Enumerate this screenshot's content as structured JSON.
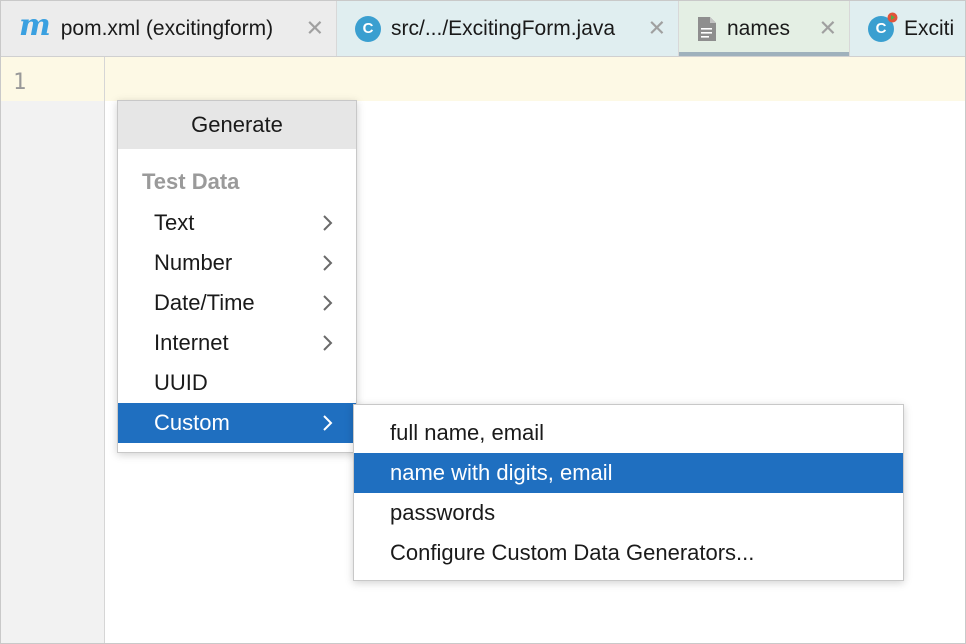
{
  "tabs": [
    {
      "label": "pom.xml (excitingform)",
      "icon": "maven-icon",
      "icon_glyph": "m"
    },
    {
      "label": "src/.../ExcitingForm.java",
      "icon": "java-class-icon",
      "icon_glyph": "C"
    },
    {
      "label": "names",
      "icon": "text-file-icon",
      "active": true
    },
    {
      "label": "Exciti",
      "icon": "java-class-run-icon",
      "icon_glyph": "C"
    }
  ],
  "tab_close_glyph": "✕",
  "editor": {
    "line_numbers": [
      "1"
    ],
    "current_line_color": "#fdf9e5"
  },
  "generate_popup": {
    "title": "Generate",
    "section_label": "Test Data",
    "items": [
      {
        "label": "Text",
        "has_submenu": true
      },
      {
        "label": "Number",
        "has_submenu": true
      },
      {
        "label": "Date/Time",
        "has_submenu": true
      },
      {
        "label": "Internet",
        "has_submenu": true
      },
      {
        "label": "UUID",
        "has_submenu": false
      },
      {
        "label": "Custom",
        "has_submenu": true,
        "selected": true
      }
    ]
  },
  "custom_submenu": {
    "items": [
      {
        "label": "full name, email"
      },
      {
        "label": "name with digits, email",
        "selected": true
      },
      {
        "label": "passwords"
      },
      {
        "label": "Configure Custom Data Generators..."
      }
    ]
  },
  "colors": {
    "selection": "#1f6fc0",
    "accent_maven": "#3aa0e0",
    "java_class": "#3a9fd0"
  }
}
